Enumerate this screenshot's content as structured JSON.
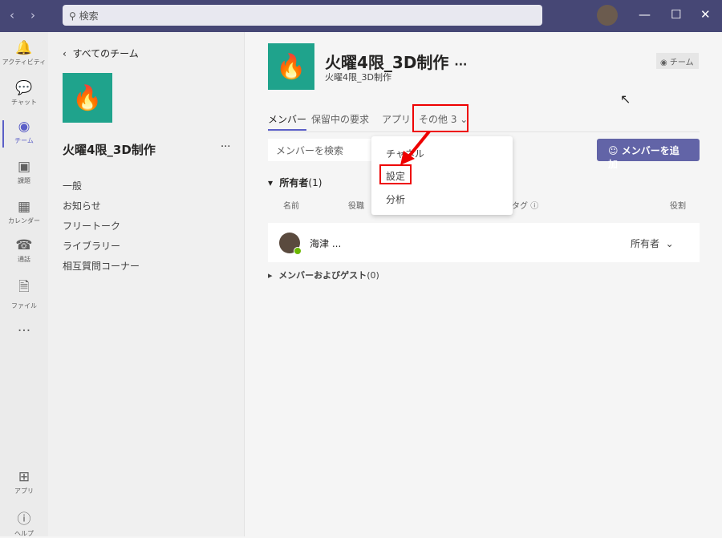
{
  "search": {
    "placeholder": "検索"
  },
  "rail": [
    {
      "label": "アクティビティ",
      "icon": "bell-icon"
    },
    {
      "label": "チャット",
      "icon": "chat-icon"
    },
    {
      "label": "チーム",
      "icon": "teams-icon"
    },
    {
      "label": "課題",
      "icon": "backpack-icon"
    },
    {
      "label": "カレンダー",
      "icon": "calendar-icon"
    },
    {
      "label": "通話",
      "icon": "phone-icon"
    },
    {
      "label": "ファイル",
      "icon": "file-icon"
    },
    {
      "label": "...",
      "icon": "more-icon"
    }
  ],
  "rail_bottom": [
    {
      "label": "アプリ"
    },
    {
      "label": "ヘルプ"
    }
  ],
  "left": {
    "back": "すべてのチーム",
    "team_name": "火曜4限_3D制作",
    "more": "···",
    "channels": [
      "一般",
      "お知らせ",
      "フリートーク",
      "ライブラリー",
      "相互質問コーナー"
    ]
  },
  "header": {
    "title": "火曜4限_3D制作",
    "subtitle": "火曜4限_3D制作",
    "more": "···",
    "team_badge": "チーム"
  },
  "tabs": [
    "メンバー",
    "保留中の要求",
    "アプリ",
    "その他 3"
  ],
  "member_search": {
    "placeholder": "メンバーを検索"
  },
  "add_member": "メンバーを追加",
  "owners": {
    "label": "所有者",
    "count": "(1)"
  },
  "columns": {
    "name": "名前",
    "title": "役職",
    "tags": "タグ",
    "role": "役割"
  },
  "member": {
    "name": "海津 ...",
    "role": "所有者"
  },
  "guests": {
    "label": "メンバーおよびゲスト",
    "count": "(0)"
  },
  "menu": [
    "チャネル",
    "設定",
    "分析"
  ],
  "colors": {
    "accent": "#5b5fc7",
    "titlebar": "#464775",
    "highlight": "#e00000"
  }
}
